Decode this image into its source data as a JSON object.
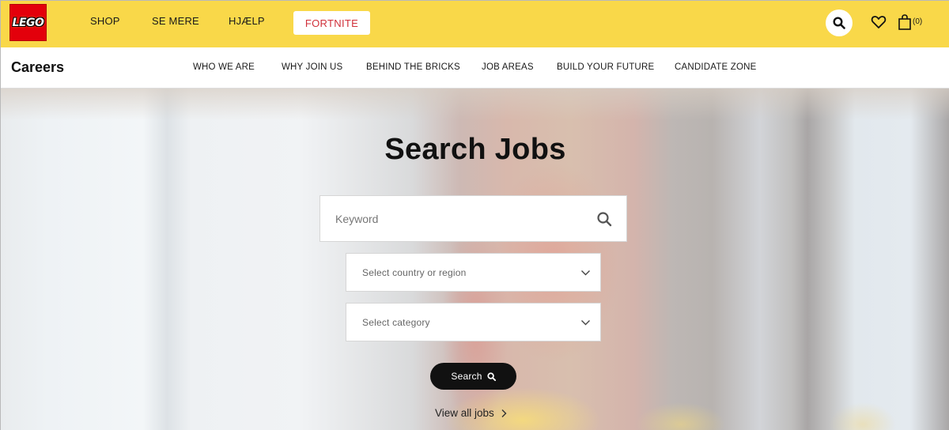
{
  "topbar": {
    "logo_text": "LEGO",
    "nav": [
      "SHOP",
      "SE MERE",
      "HJÆLP"
    ],
    "promo_label": "FORTNITE",
    "bag_count": "(0)",
    "colors": {
      "background": "#f9d849",
      "logo_red": "#e3000b",
      "promo_text": "#d0303a"
    }
  },
  "careers": {
    "title": "Careers",
    "nav": [
      "WHO WE ARE",
      "WHY JOIN US",
      "BEHIND THE BRICKS",
      "JOB AREAS",
      "BUILD YOUR FUTURE",
      "CANDIDATE ZONE"
    ]
  },
  "hero": {
    "title": "Search Jobs",
    "keyword_placeholder": "Keyword",
    "country_select": "Select country or region",
    "category_select": "Select category",
    "search_button": "Search",
    "view_all_link": "View all jobs"
  },
  "icons": {
    "header_search": "search-icon",
    "wishlist": "heart-icon",
    "bag": "shopping-bag-icon",
    "dropdown": "chevron-down-icon",
    "view_all_arrow": "chevron-right-icon"
  }
}
